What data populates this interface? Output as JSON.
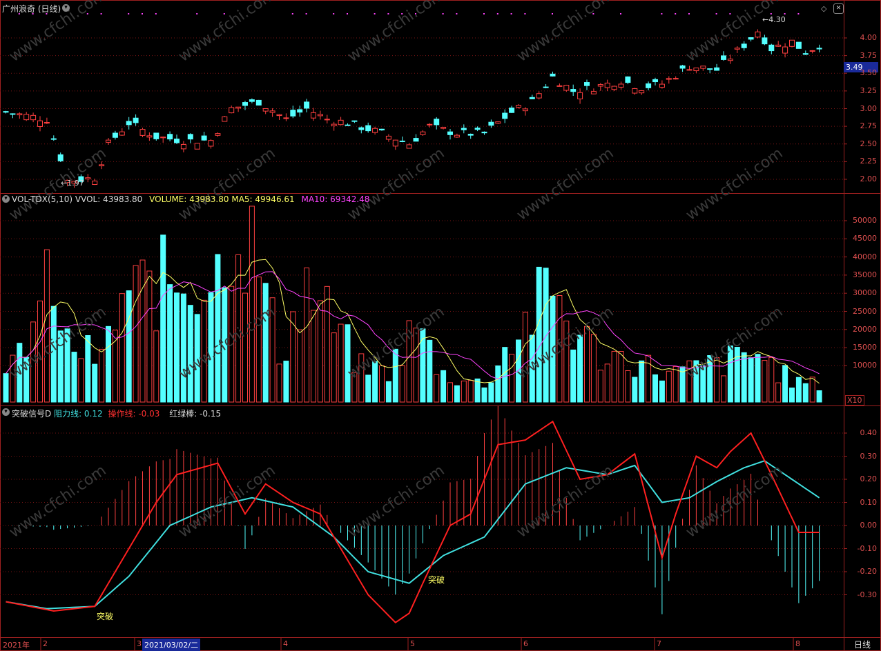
{
  "stock": {
    "title": "广州浪奇 (日线)",
    "current_price": "3.49",
    "high_label": "4.30",
    "low_label": "1.97"
  },
  "price_axis": [
    "4.00",
    "3.75",
    "3.50",
    "3.25",
    "3.00",
    "2.75",
    "2.50",
    "2.25",
    "2.00"
  ],
  "volume_header": {
    "name": "VOL-TDX(5,10)",
    "vvol": "VVOL: 43983.80",
    "volume": "VOLUME: 43983.80",
    "ma5": "MA5: 49946.61",
    "ma10": "MA10: 69342.48"
  },
  "volume_axis": [
    "50000",
    "45000",
    "40000",
    "35000",
    "30000",
    "25000",
    "20000",
    "15000",
    "10000"
  ],
  "volume_unit": "X10",
  "indicator_header": {
    "name": "突破信号D",
    "resist": "阻力线: 0.12",
    "operate": "操作线: -0.03",
    "bar": "红绿棒: -0.15"
  },
  "indicator_axis": [
    "0.40",
    "0.30",
    "0.20",
    "0.10",
    "0.00",
    "-0.10",
    "-0.20",
    "-0.30"
  ],
  "signals": [
    "突破",
    "突破"
  ],
  "x_axis": {
    "year": "2021年",
    "months": [
      "2",
      "3",
      "4",
      "5",
      "6",
      "7",
      "8"
    ],
    "cursor_date": "2021/03/02/二"
  },
  "period": "日线",
  "watermark": "www.cfchi.com",
  "colors": {
    "up": "#ff4040",
    "down": "#54ffff",
    "ma5": "#ffff66",
    "ma10": "#ff44ff",
    "grid": "#7a1414",
    "axis": "#a02020",
    "operate": "#ff2020",
    "resist": "#40e0e0"
  }
}
